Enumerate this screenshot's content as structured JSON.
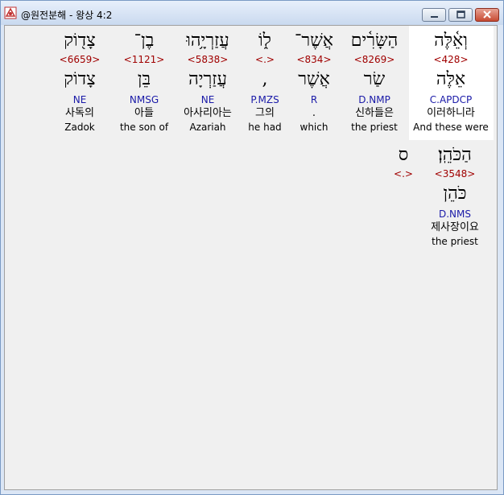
{
  "window": {
    "title": "@원전분해 - 왕상 4:2"
  },
  "words": [
    {
      "hebrew": "וְאֵ֫לֶּה",
      "strong": "<428>",
      "lemma": "אֵלֶּה",
      "morph": "C.APDCP",
      "korean": "이러하니라",
      "english": "And these were"
    },
    {
      "hebrew": "הַשָּׂרִ֫ים",
      "strong": "<8269>",
      "lemma": "שַׂר",
      "morph": "D.NMP",
      "korean": "신하들은",
      "english": "the priest"
    },
    {
      "hebrew": "אֲשֶׁר־",
      "strong": "<834>",
      "lemma": "אֲשֶׁר",
      "morph": "R",
      "korean": ".",
      "english": "which"
    },
    {
      "hebrew": "ל֑וֹ",
      "strong": "<.>",
      "lemma": ",",
      "morph": "P.MZS",
      "korean": "그의",
      "english": "he had"
    },
    {
      "hebrew": "עֲזַרְיָ֥הוּ",
      "strong": "<5838>",
      "lemma": "עֲזַרְיָה",
      "morph": "NE",
      "korean": "아사리아는",
      "english": "Azariah"
    },
    {
      "hebrew": "בֶן־",
      "strong": "<1121>",
      "lemma": "בֵּן",
      "morph": "NMSG",
      "korean": "아들",
      "english": "the son of"
    },
    {
      "hebrew": "צָד֖וֹק",
      "strong": "<6659>",
      "lemma": "צָדוֹק",
      "morph": "NE",
      "korean": "사독의",
      "english": "Zadok"
    },
    {
      "hebrew": "הַכֹּהֵֽן׃",
      "strong": "<3548>",
      "lemma": "כֹּהֵן",
      "morph": "D.NMS",
      "korean": "제사장이요",
      "english": "the priest"
    },
    {
      "hebrew": "ס",
      "strong": "<.>",
      "lemma": "",
      "morph": "",
      "korean": "",
      "english": ""
    }
  ],
  "colors": {
    "strong": "#a00000",
    "morph": "#1a1aa8",
    "highlight": "#ffffff",
    "background": "#f0f0f0"
  }
}
